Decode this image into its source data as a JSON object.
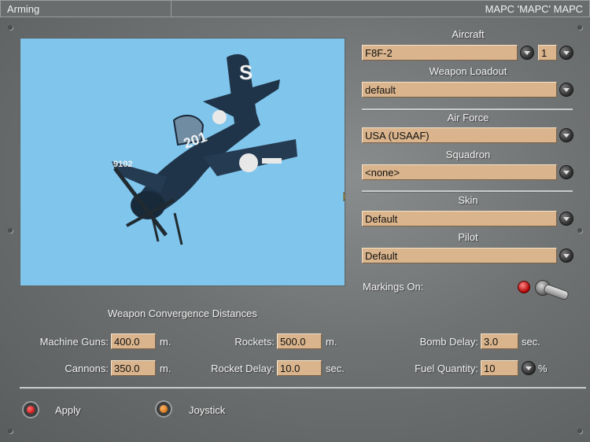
{
  "window": {
    "left_title": "Arming",
    "right_title": "МАРС 'МАРС' МАРС"
  },
  "preview": {
    "aircraft_tail_code": "S",
    "aircraft_number": "201",
    "aircraft_side_number": "9102"
  },
  "aircraft": {
    "label": "Aircraft",
    "value": "F8F-2",
    "count": "1"
  },
  "weapon_loadout": {
    "label": "Weapon Loadout",
    "value": "default"
  },
  "air_force": {
    "label": "Air Force",
    "value": "USA (USAAF)"
  },
  "squadron": {
    "label": "Squadron",
    "value": "<none>"
  },
  "skin": {
    "label": "Skin",
    "value": "Default"
  },
  "pilot": {
    "label": "Pilot",
    "value": "Default"
  },
  "markings": {
    "label": "Markings On:"
  },
  "convergence": {
    "title": "Weapon Convergence Distances",
    "machine_guns_label": "Machine Guns:",
    "machine_guns_value": "400.0",
    "cannons_label": "Cannons:",
    "cannons_value": "350.0",
    "rockets_label": "Rockets:",
    "rockets_value": "500.0",
    "rocket_delay_label": "Rocket Delay:",
    "rocket_delay_value": "10.0",
    "bomb_delay_label": "Bomb Delay:",
    "bomb_delay_value": "3.0",
    "fuel_label": "Fuel Quantity:",
    "fuel_value": "10",
    "unit_m": "m.",
    "unit_sec": "sec.",
    "unit_pct": "%"
  },
  "footer": {
    "apply_label": "Apply",
    "joystick_label": "Joystick"
  },
  "colors": {
    "field_bg": "#d9b48c",
    "sky": "#80c5ec",
    "apply_light": "#d01818",
    "joystick_light": "#d87a18"
  }
}
